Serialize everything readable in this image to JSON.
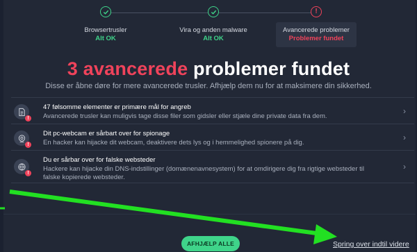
{
  "steps": [
    {
      "label": "Browsertrusler",
      "status": "Alt OK",
      "state": "ok"
    },
    {
      "label": "Vira og anden malware",
      "status": "Alt OK",
      "state": "ok"
    },
    {
      "label": "Avancerede problemer",
      "status": "Problemer fundet",
      "state": "alert",
      "alert_glyph": "!"
    }
  ],
  "headline": {
    "count": "3 avancerede",
    "rest": "problemer fundet"
  },
  "subline": "Disse er åbne døre for mere avancerede trusler. Afhjælp dem nu for at maksimere din sikkerhed.",
  "items": [
    {
      "icon": "document-icon",
      "title": "47 følsomme elementer er primære mål for angreb",
      "desc": "Avancerede trusler kan muligvis tage disse filer som gidsler eller stjæle dine private data fra dem."
    },
    {
      "icon": "webcam-icon",
      "title": "Dit pc-webcam er sårbart over for spionage",
      "desc": "En hacker kan hijacke dit webcam, deaktivere dets lys og i hemmelighed spionere på dig."
    },
    {
      "icon": "globe-icon",
      "title": "Du er sårbar over for falske websteder",
      "desc": "Hackere kan hijacke din DNS-indstillinger (domænenavnesystem) for at omdirigere dig fra rigtige websteder til falske kopierede websteder."
    }
  ],
  "badge_glyph": "!",
  "chevron": "›",
  "fix_all_label": "AFHJÆLP ALLE",
  "skip_label": "Spring over indtil videre",
  "colors": {
    "accent_green": "#3fd48a",
    "alert_red": "#f0435b",
    "background": "#222836",
    "arrow": "#22e022"
  }
}
